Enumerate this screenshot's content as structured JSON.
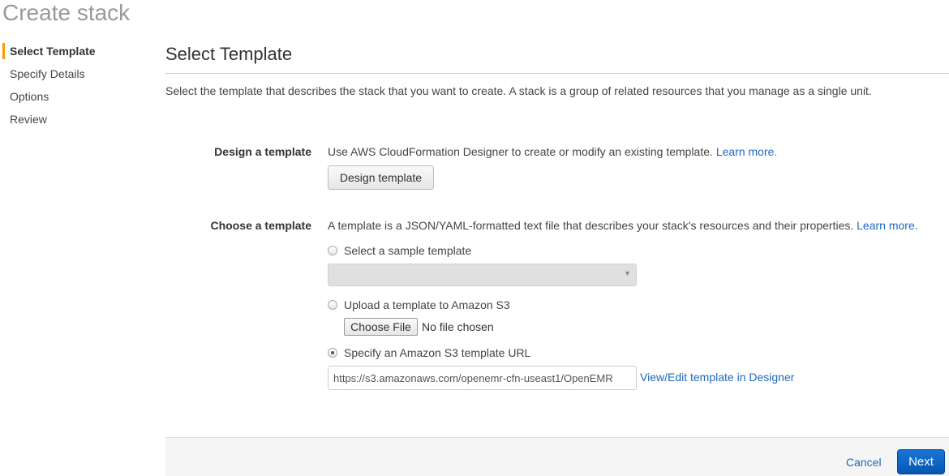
{
  "page_title": "Create stack",
  "sidebar": {
    "items": [
      {
        "label": "Select Template",
        "active": true
      },
      {
        "label": "Specify Details"
      },
      {
        "label": "Options"
      },
      {
        "label": "Review"
      }
    ]
  },
  "main": {
    "heading": "Select Template",
    "description": "Select the template that describes the stack that you want to create. A stack is a group of related resources that you manage as a single unit.",
    "design": {
      "label": "Design a template",
      "text": "Use AWS CloudFormation Designer to create or modify an existing template.",
      "learn_more": "Learn more.",
      "button": "Design template"
    },
    "choose": {
      "label": "Choose a template",
      "text": "A template is a JSON/YAML-formatted text file that describes your stack's resources and their properties.",
      "learn_more": "Learn more.",
      "options": [
        {
          "label": "Select a sample template",
          "selected": false
        },
        {
          "label": "Upload a template to Amazon S3",
          "selected": false
        },
        {
          "label": "Specify an Amazon S3 template URL",
          "selected": true
        }
      ],
      "sample_select_value": "",
      "choose_file": "Choose File",
      "no_file": "No file chosen",
      "url_value": "https://s3.amazonaws.com/openemr-cfn-useast1/OpenEMR",
      "designer_link": "View/Edit template in Designer"
    }
  },
  "footer": {
    "cancel": "Cancel",
    "next": "Next"
  },
  "colors": {
    "accent": "#ff9900",
    "link": "#1e68c0",
    "primary": "#0a63c2"
  }
}
